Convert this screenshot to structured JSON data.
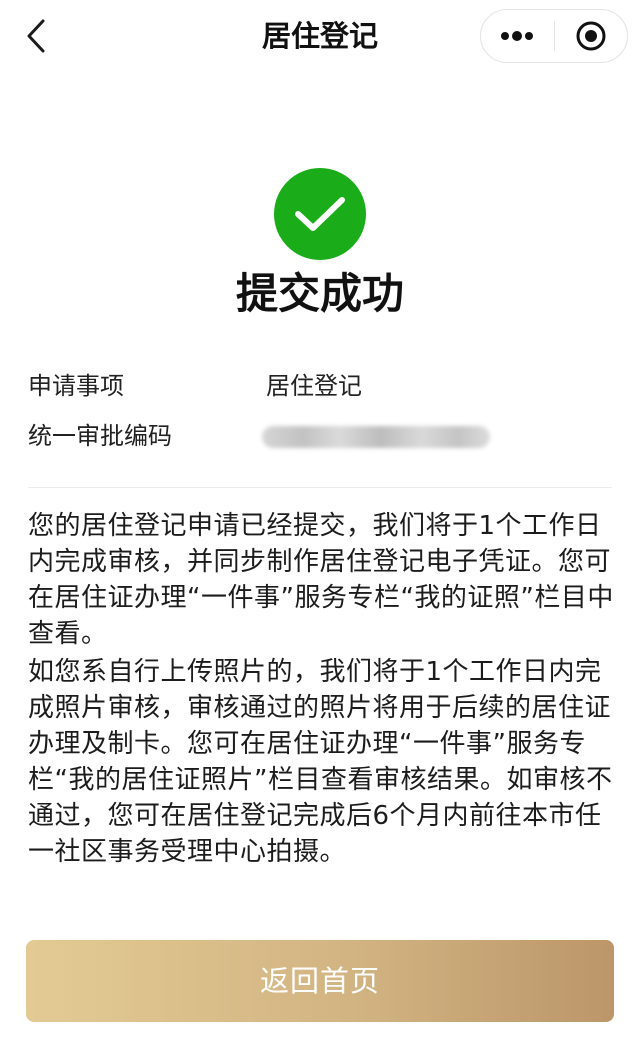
{
  "header": {
    "title": "居住登记",
    "back_icon": "chevron-left-icon",
    "more_icon": "more-dots-icon",
    "close_icon": "target-circle-icon"
  },
  "result": {
    "icon": "check-circle-icon",
    "icon_color": "#1aad19",
    "title": "提交成功"
  },
  "details": {
    "item_label": "申请事项",
    "item_value": "居住登记",
    "code_label": "统一审批编码"
  },
  "notes": {
    "paragraph1": "您的居住登记申请已经提交，我们将于1个工作日内完成审核，并同步制作居住登记电子凭证。您可在居住证办理“一件事”服务专栏“我的证照”栏目中查看。",
    "paragraph2": "如您系自行上传照片的，我们将于1个工作日内完成照片审核，审核通过的照片将用于后续的居住证办理及制卡。您可在居住证办理“一件事”服务专栏“我的居住证照片”栏目查看审核结果。如审核不通过，您可在居住登记完成后6个月内前往本市任一社区事务受理中心拍摄。"
  },
  "footer": {
    "home_button": "返回首页"
  }
}
